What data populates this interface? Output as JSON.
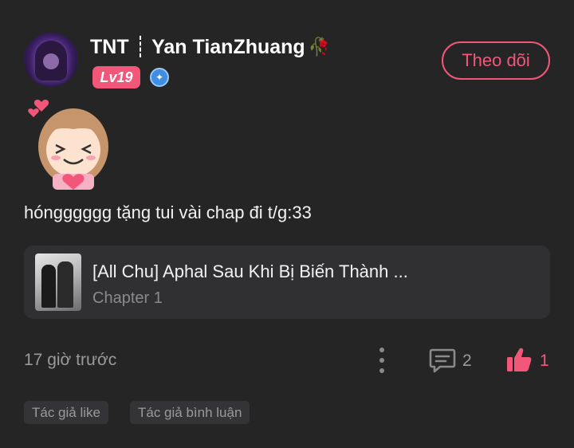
{
  "post": {
    "username": "TNT ┊ Yan TianZhuang",
    "level_badge": "Lv19",
    "follow_label": "Theo dõi",
    "comment_text": "hóngggggg tặng tui vài chap đi t/g:33",
    "time": "17 giờ trước",
    "comment_count": "2",
    "like_count": "1"
  },
  "chapter_card": {
    "title": "[All Chu] Aphal Sau Khi Bị Biến Thành ...",
    "subtitle": "Chapter 1"
  },
  "tags": [
    "Tác giả like",
    "Tác giả bình luận"
  ],
  "colors": {
    "background": "#252526",
    "accent": "#f2577a",
    "card": "#303032",
    "muted_text": "#9a9a9a",
    "verify_blue": "#3f8ee6"
  },
  "icons": [
    "rose-icon",
    "verify-icon",
    "more-vertical-icon",
    "comment-icon",
    "thumbs-up-icon"
  ]
}
